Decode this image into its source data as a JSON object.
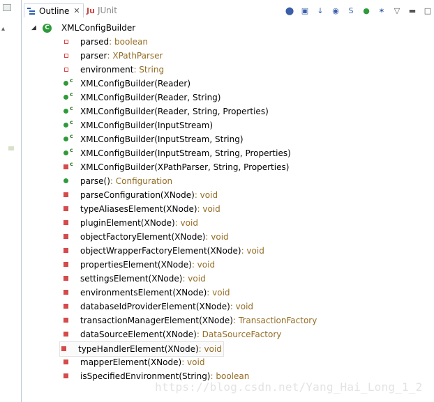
{
  "tabs": {
    "outline": "Outline",
    "junit": "JUnit"
  },
  "root": {
    "label": "XMLConfigBuilder",
    "badge": "C"
  },
  "members": [
    {
      "name": "parsed",
      "type": " : boolean",
      "kind": "field"
    },
    {
      "name": "parser",
      "type": " : XPathParser",
      "kind": "field"
    },
    {
      "name": "environment",
      "type": " : String",
      "kind": "field"
    },
    {
      "name": "XMLConfigBuilder(Reader)",
      "type": "",
      "kind": "public-ctor"
    },
    {
      "name": "XMLConfigBuilder(Reader, String)",
      "type": "",
      "kind": "public-ctor"
    },
    {
      "name": "XMLConfigBuilder(Reader, String, Properties)",
      "type": "",
      "kind": "public-ctor"
    },
    {
      "name": "XMLConfigBuilder(InputStream)",
      "type": "",
      "kind": "public-ctor"
    },
    {
      "name": "XMLConfigBuilder(InputStream, String)",
      "type": "",
      "kind": "public-ctor"
    },
    {
      "name": "XMLConfigBuilder(InputStream, String, Properties)",
      "type": "",
      "kind": "public-ctor"
    },
    {
      "name": "XMLConfigBuilder(XPathParser, String, Properties)",
      "type": "",
      "kind": "private-ctor"
    },
    {
      "name": "parse()",
      "type": " : Configuration",
      "kind": "public-method"
    },
    {
      "name": "parseConfiguration(XNode)",
      "type": " : void",
      "kind": "private-method"
    },
    {
      "name": "typeAliasesElement(XNode)",
      "type": " : void",
      "kind": "private-method"
    },
    {
      "name": "pluginElement(XNode)",
      "type": " : void",
      "kind": "private-method"
    },
    {
      "name": "objectFactoryElement(XNode)",
      "type": " : void",
      "kind": "private-method"
    },
    {
      "name": "objectWrapperFactoryElement(XNode)",
      "type": " : void",
      "kind": "private-method"
    },
    {
      "name": "propertiesElement(XNode)",
      "type": " : void",
      "kind": "private-method"
    },
    {
      "name": "settingsElement(XNode)",
      "type": " : void",
      "kind": "private-method"
    },
    {
      "name": "environmentsElement(XNode)",
      "type": " : void",
      "kind": "private-method"
    },
    {
      "name": "databaseIdProviderElement(XNode)",
      "type": " : void",
      "kind": "private-method"
    },
    {
      "name": "transactionManagerElement(XNode)",
      "type": " : TransactionFactory",
      "kind": "private-method"
    },
    {
      "name": "dataSourceElement(XNode)",
      "type": " : DataSourceFactory",
      "kind": "private-method"
    },
    {
      "name": "typeHandlerElement(XNode)",
      "type": " : void",
      "kind": "private-method",
      "selected": true
    },
    {
      "name": "mapperElement(XNode)",
      "type": " : void",
      "kind": "private-method"
    },
    {
      "name": "isSpecifiedEnvironment(String)",
      "type": " : boolean",
      "kind": "private-method"
    }
  ],
  "watermark": "https://blog.csdn.net/Yang_Hai_Long_1_2"
}
